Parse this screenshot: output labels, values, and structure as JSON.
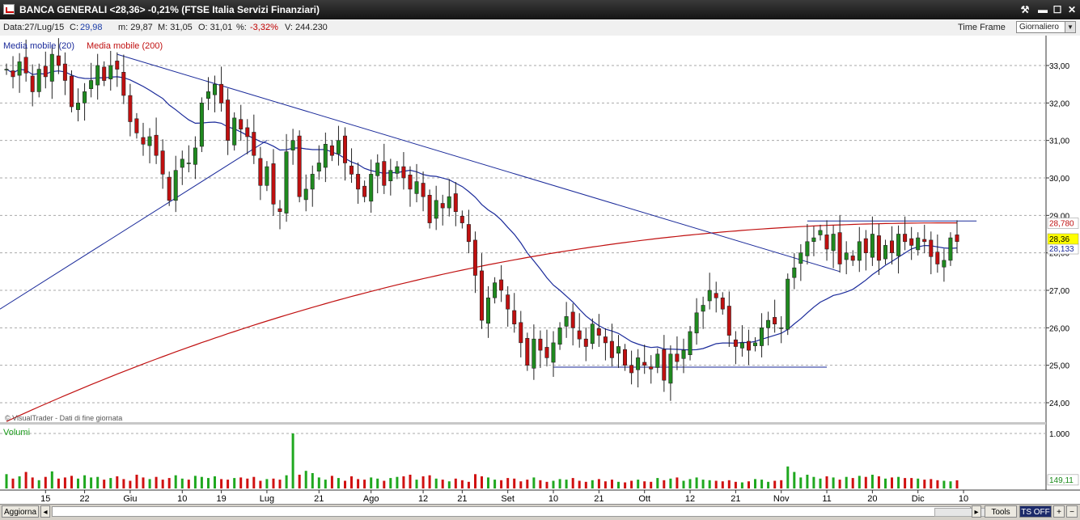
{
  "window": {
    "title": "BANCA GENERALI <28,36> -0,21%  (FTSE Italia Servizi Finanziari)",
    "btn_tools": "⚒",
    "btn_min": "▬",
    "btn_max": "☐",
    "btn_close": "✕"
  },
  "infobar": {
    "data": "Data:27/Lug/15",
    "c_label": "C:",
    "c_value": "29,98",
    "m": "m: 29,87",
    "max": "M: 31,05",
    "o": "O: 31,01",
    "pct_label": "%:",
    "pct_value": "-3,32%",
    "v": "V: 244.230",
    "timeframe_label": "Time Frame",
    "timeframe_value": "Giornaliero"
  },
  "bottombar": {
    "update_label": "Aggiorna",
    "tools_label": "Tools",
    "ts_label": "TS OFF",
    "plus": "+"
  },
  "chart_data": {
    "type": "candlestick",
    "legend": [
      "Media mobile (20)",
      "Media mobile (200)"
    ],
    "watermark": "© VisualTrader - Dati di fine giornata",
    "volume_label": "Volumi",
    "price_axis": {
      "ticks": [
        "33,00",
        "32,00",
        "31,00",
        "30,00",
        "29,00",
        "28,00",
        "27,00",
        "26,00",
        "25,00",
        "24,00"
      ],
      "ylim": [
        23.7,
        33.9
      ]
    },
    "current_price_label": "28,36",
    "ma200_label": "28,780",
    "ma20_label": "28,133",
    "volume_axis": {
      "ticks": [
        "1.000"
      ],
      "last_label": "149,11"
    },
    "x_ticks": [
      "15",
      "22",
      "Giu",
      "10",
      "19",
      "Lug",
      "21",
      "Ago",
      "12",
      "21",
      "Set",
      "10",
      "21",
      "Ott",
      "12",
      "21",
      "Nov",
      "11",
      "20",
      "Dic",
      "10"
    ],
    "closes": [
      32.9,
      32.7,
      33.1,
      32.8,
      32.3,
      32.9,
      32.7,
      33.3,
      33.0,
      32.6,
      31.9,
      32.0,
      32.3,
      32.6,
      33.0,
      32.6,
      33.0,
      32.9,
      32.2,
      31.5,
      31.2,
      30.9,
      31.1,
      30.6,
      30.1,
      29.4,
      30.2,
      30.5,
      30.4,
      30.8,
      32.0,
      32.3,
      32.5,
      32.0,
      31.0,
      31.6,
      31.3,
      31.1,
      30.6,
      29.8,
      30.3,
      29.3,
      29.1,
      30.7,
      31.0,
      29.5,
      29.7,
      30.1,
      30.4,
      30.9,
      30.6,
      31.0,
      30.4,
      30.1,
      29.7,
      29.5,
      30.1,
      30.4,
      29.8,
      30.2,
      30.3,
      30.0,
      29.7,
      29.9,
      29.5,
      28.8,
      29.4,
      29.2,
      29.5,
      29.1,
      28.8,
      28.3,
      27.4,
      26.2,
      26.8,
      27.2,
      27.0,
      26.5,
      26.1,
      25.6,
      25.0,
      25.7,
      25.4,
      25.2,
      25.6,
      26.0,
      26.3,
      26.0,
      25.7,
      25.5,
      26.1,
      25.8,
      25.6,
      25.2,
      25.5,
      25.0,
      24.8,
      25.2,
      25.0,
      24.9,
      25.3,
      24.6,
      25.3,
      25.1,
      25.4,
      25.9,
      26.4,
      26.6,
      27.0,
      26.8,
      26.5,
      25.8,
      25.5,
      25.6,
      25.4,
      25.6,
      26.0,
      26.2,
      26.1,
      26.0,
      27.3,
      27.6,
      28.0,
      28.3,
      28.4,
      28.6,
      28.1,
      28.5,
      27.7,
      28.0,
      27.8,
      28.3,
      28.0,
      28.5,
      27.8,
      28.2,
      28.0,
      28.5,
      28.3,
      28.2,
      28.4,
      28.3,
      27.9,
      27.7,
      27.8,
      28.4,
      28.3
    ],
    "volumes": [
      260,
      180,
      220,
      300,
      200,
      150,
      210,
      310,
      180,
      200,
      230,
      180,
      240,
      200,
      210,
      160,
      190,
      220,
      170,
      140,
      250,
      200,
      170,
      210,
      160,
      190,
      240,
      180,
      160,
      230,
      210,
      190,
      220,
      170,
      160,
      190,
      200,
      180,
      210,
      140,
      170,
      180,
      160,
      240,
      1000,
      250,
      320,
      280,
      200,
      160,
      230,
      190,
      140,
      220,
      170,
      160,
      200,
      180,
      140,
      190,
      210,
      220,
      250,
      160,
      220,
      240,
      180,
      160,
      130,
      180,
      150,
      120,
      260,
      220,
      200,
      160,
      150,
      190,
      180,
      130,
      160,
      200,
      150,
      120,
      140,
      170,
      160,
      190,
      140,
      120,
      150,
      170,
      130,
      160,
      120,
      110,
      140,
      160,
      130,
      120,
      190,
      150,
      180,
      200,
      140,
      170,
      200,
      160,
      150,
      140,
      130,
      150,
      120,
      110,
      130,
      170,
      160,
      120,
      140,
      150,
      400,
      300,
      200,
      250,
      210,
      180,
      220,
      200,
      160,
      210,
      190,
      230,
      210,
      250,
      220,
      180,
      200,
      210,
      190,
      190,
      180,
      160,
      170,
      150,
      140,
      130,
      149
    ]
  }
}
